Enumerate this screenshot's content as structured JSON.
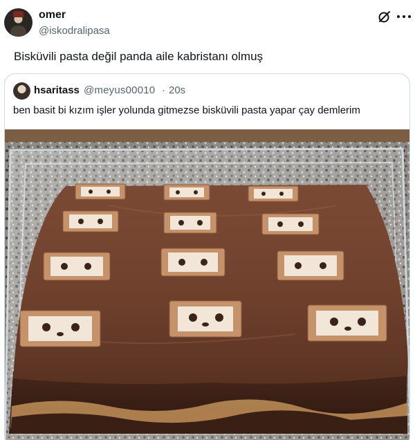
{
  "author": {
    "name": "omer",
    "handle": "@iskodralipasa"
  },
  "tweet": {
    "text": "Bisküvili pasta değil panda aile kabristanı olmuş"
  },
  "quoted": {
    "name": "hsaritass",
    "handle": "@meyus00010",
    "separator": "·",
    "time": "20s",
    "text": "ben basit bi kızım işler yolunda gitmezse bisküvili pasta yapar çay demlerim"
  },
  "icons": {
    "grok": "grok-icon",
    "more": "more-icon"
  }
}
